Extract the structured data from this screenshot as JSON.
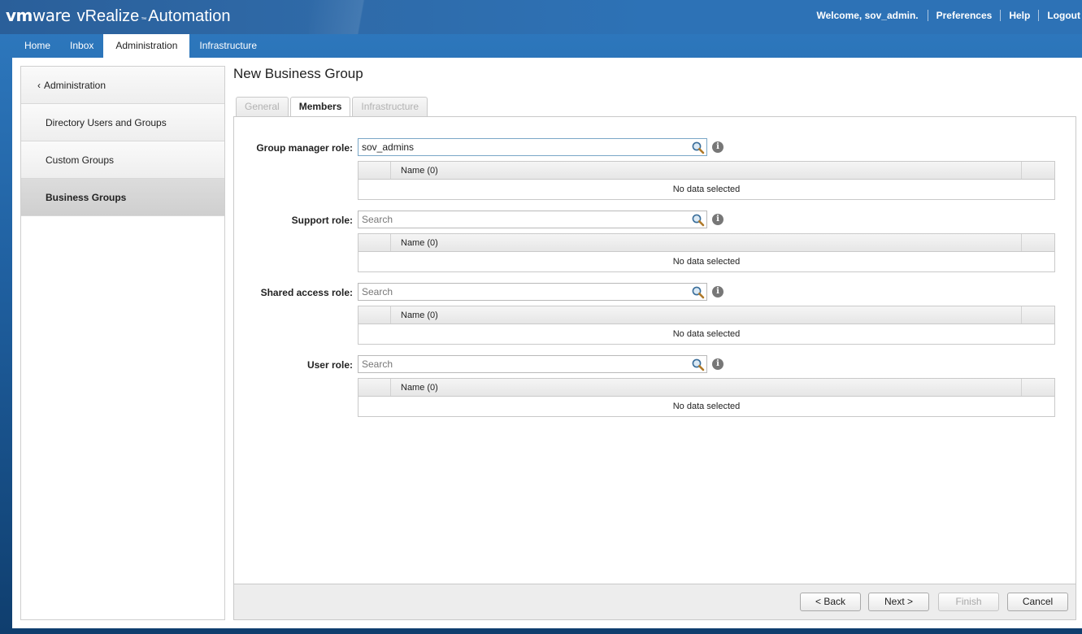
{
  "header": {
    "brand_vm": "vm",
    "brand_ware": "ware",
    "brand_product_1": "vRealize",
    "brand_tm": "™",
    "brand_product_2": "Automation",
    "welcome": "Welcome, sov_admin.",
    "preferences": "Preferences",
    "help": "Help",
    "logout": "Logout"
  },
  "tabs": [
    {
      "label": "Home"
    },
    {
      "label": "Inbox"
    },
    {
      "label": "Administration",
      "active": true
    },
    {
      "label": "Infrastructure"
    }
  ],
  "sidebar": {
    "back_chevron": "‹",
    "back_label": "Administration",
    "items": [
      {
        "label": "Directory Users and Groups"
      },
      {
        "label": "Custom Groups"
      },
      {
        "label": "Business Groups",
        "selected": true
      }
    ]
  },
  "page": {
    "title": "New Business Group"
  },
  "wizard_tabs": [
    {
      "label": "General",
      "state": "disabled"
    },
    {
      "label": "Members",
      "state": "active"
    },
    {
      "label": "Infrastructure",
      "state": "disabled"
    }
  ],
  "roles": [
    {
      "label": "Group manager role:",
      "value": "sov_admins",
      "placeholder": "Search",
      "column": "Name (0)",
      "empty": "No data selected"
    },
    {
      "label": "Support role:",
      "value": "",
      "placeholder": "Search",
      "column": "Name (0)",
      "empty": "No data selected"
    },
    {
      "label": "Shared access role:",
      "value": "",
      "placeholder": "Search",
      "column": "Name (0)",
      "empty": "No data selected"
    },
    {
      "label": "User role:",
      "value": "",
      "placeholder": "Search",
      "column": "Name (0)",
      "empty": "No data selected"
    }
  ],
  "info_glyph": "i",
  "footer": {
    "back": "< Back",
    "next": "Next >",
    "finish": "Finish",
    "cancel": "Cancel"
  },
  "icons": {
    "search": "magnifier-icon",
    "info": "info-icon",
    "back": "chevron-left-icon"
  }
}
